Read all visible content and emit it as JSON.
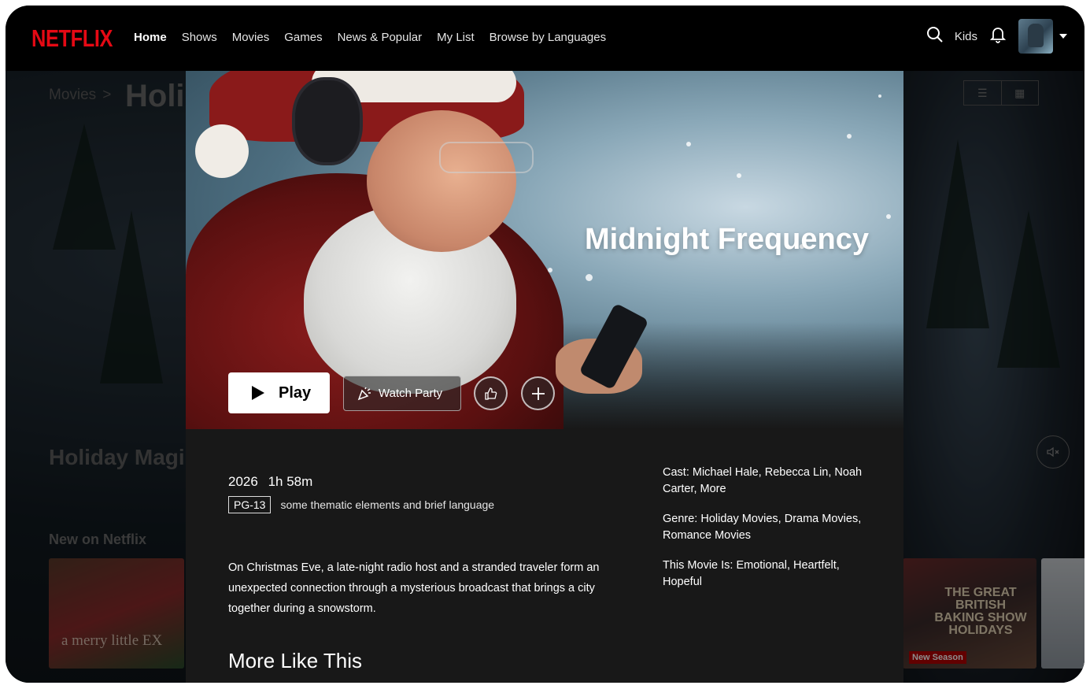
{
  "brand": {
    "logo_text": "NETFLIX",
    "accent_color": "#e50914"
  },
  "nav": {
    "links": [
      "Home",
      "Shows",
      "Movies",
      "Games",
      "News & Popular",
      "My List",
      "Browse by Languages"
    ],
    "active": "Home",
    "kids_label": "Kids",
    "icons": [
      "search-icon",
      "bell-icon",
      "avatar",
      "caret-down-icon"
    ]
  },
  "background": {
    "breadcrumb": [
      "Movies",
      ">"
    ],
    "page_title": "Holi",
    "row_title": "Holiday Magi",
    "new_row_title": "New on Netflix",
    "thumb_left_text": "a merry little EX",
    "thumb_right_title": "THE GREAT BRITISH BAKING SHOW HOLIDAYS",
    "thumb_right_badge": "New Season",
    "icons": [
      "list-view-icon",
      "grid-view-icon",
      "mute-icon"
    ]
  },
  "modal": {
    "title": "Midnight Frequency",
    "play_label": "Play",
    "watch_party_label": "Watch Party",
    "icons": [
      "play-icon",
      "party-icon",
      "thumbs-up-icon",
      "plus-icon"
    ],
    "year": "2026",
    "duration": "1h 58m",
    "rating": "PG-13",
    "advisory": "some thematic elements and brief language",
    "description": "On Christmas Eve, a late-night radio host and a stranded traveler form an unexpected connection through a mysterious broadcast that brings a city together during a snowstorm.",
    "cast": "Cast: Michael Hale, Rebecca Lin, Noah Carter, More",
    "genre": "Genre: Holiday Movies, Drama Movies, Romance Movies",
    "this_movie_is": "This Movie Is: Emotional, Heartfelt, Hopeful",
    "more_like_this": "More Like This"
  }
}
